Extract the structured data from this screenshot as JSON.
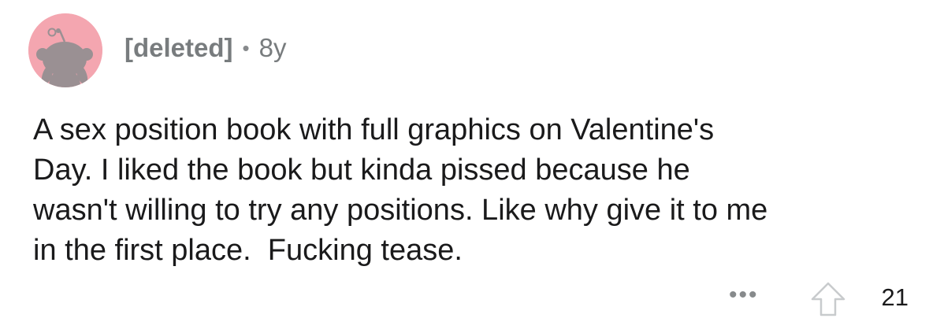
{
  "comment": {
    "author": "[deleted]",
    "separator": "•",
    "age": "8y",
    "body": "A sex position book with full graphics on Valentine's\nDay. I liked the book but kinda pissed because he\nwasn't willing to try any positions. Like why give it to me\nin the first place.  Fucking tease.",
    "score": "21",
    "more_label": "•••"
  },
  "icons": {
    "avatar": "reddit-snoo-avatar-icon",
    "upvote": "upvote-arrow-icon"
  },
  "colors": {
    "avatar_background": "#f4a6b0",
    "avatar_figure": "#9a9093",
    "meta_text": "#787c7e",
    "body_text": "#1a1a1b"
  }
}
